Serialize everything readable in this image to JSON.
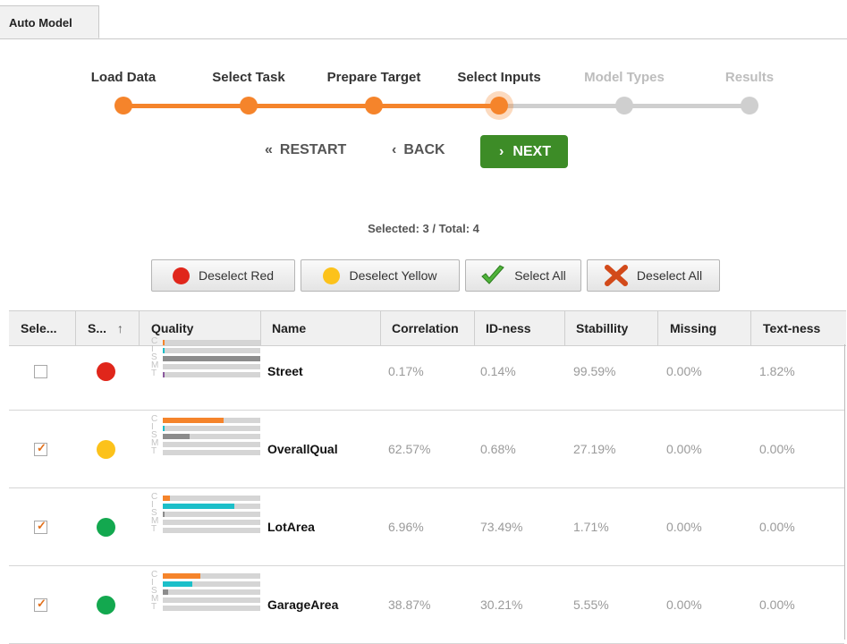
{
  "tab": {
    "label": "Auto Model"
  },
  "steps": [
    {
      "label": "Load Data",
      "state": "done"
    },
    {
      "label": "Select Task",
      "state": "done"
    },
    {
      "label": "Prepare Target",
      "state": "done"
    },
    {
      "label": "Select Inputs",
      "state": "current"
    },
    {
      "label": "Model Types",
      "state": "future"
    },
    {
      "label": "Results",
      "state": "future"
    }
  ],
  "nav": {
    "restart": {
      "glyph": "«",
      "label": "RESTART"
    },
    "back": {
      "glyph": "‹",
      "label": "BACK"
    },
    "next": {
      "glyph": "›",
      "label": "NEXT"
    }
  },
  "selection_info": "Selected: 3  /  Total: 4",
  "toolbar": {
    "deselect_red": "Deselect Red",
    "deselect_yellow": "Deselect Yellow",
    "select_all": "Select All",
    "deselect_all": "Deselect All"
  },
  "colors": {
    "orange": "#f5842b",
    "teal": "#1cbfc9",
    "gray": "#8c8c8c",
    "purple": "#8b5a9e",
    "red": "#e0261b",
    "yellow": "#fcc21b",
    "green": "#13a84f",
    "next_green": "#3d8c27"
  },
  "table": {
    "headers": [
      "Sele...",
      "S...",
      "Quality",
      "Name",
      "Correlation",
      "ID-ness",
      "Stabillity",
      "Missing",
      "Text-ness"
    ],
    "sort_icon": "↑",
    "quality_letters": [
      "C",
      "I",
      "S",
      "M",
      "T"
    ],
    "rows": [
      {
        "selected": false,
        "status": "red",
        "name": "Street",
        "correlation": "0.17%",
        "idness": "0.14%",
        "stability": "99.59%",
        "missing": "0.00%",
        "textness": "1.82%",
        "quality": {
          "C": 0.0017,
          "I": 0.0014,
          "S": 0.9959,
          "M": 0.0,
          "T": 0.0182
        }
      },
      {
        "selected": true,
        "status": "yellow",
        "name": "OverallQual",
        "correlation": "62.57%",
        "idness": "0.68%",
        "stability": "27.19%",
        "missing": "0.00%",
        "textness": "0.00%",
        "quality": {
          "C": 0.6257,
          "I": 0.0068,
          "S": 0.2719,
          "M": 0.0,
          "T": 0.0
        }
      },
      {
        "selected": true,
        "status": "green",
        "name": "LotArea",
        "correlation": "6.96%",
        "idness": "73.49%",
        "stability": "1.71%",
        "missing": "0.00%",
        "textness": "0.00%",
        "quality": {
          "C": 0.0696,
          "I": 0.7349,
          "S": 0.0171,
          "M": 0.0,
          "T": 0.0
        }
      },
      {
        "selected": true,
        "status": "green",
        "name": "GarageArea",
        "correlation": "38.87%",
        "idness": "30.21%",
        "stability": "5.55%",
        "missing": "0.00%",
        "textness": "0.00%",
        "quality": {
          "C": 0.3887,
          "I": 0.3021,
          "S": 0.0555,
          "M": 0.0,
          "T": 0.0
        }
      }
    ]
  }
}
